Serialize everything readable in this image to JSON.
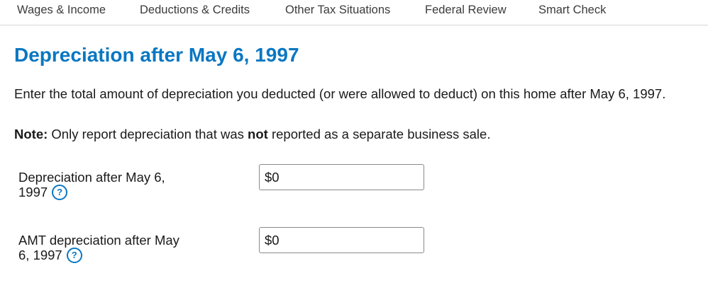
{
  "nav": {
    "items": [
      {
        "label": "Wages & Income"
      },
      {
        "label": "Deductions & Credits"
      },
      {
        "label": "Other Tax Situations"
      },
      {
        "label": "Federal Review"
      },
      {
        "label": "Smart Check"
      }
    ]
  },
  "page": {
    "title": "Depreciation after May 6, 1997",
    "instructions": "Enter the total amount of depreciation you deducted (or were allowed to deduct) on this home after May 6, 1997.",
    "note": {
      "label": "Note:",
      "text_before": " Only report depreciation that was ",
      "emphasis": "not",
      "text_after": " reported as a separate business sale."
    }
  },
  "fields": [
    {
      "label": "Depreciation after May 6, 1997",
      "value": "$0",
      "help_glyph": "?"
    },
    {
      "label": "AMT depreciation after May 6, 1997",
      "value": "$0",
      "help_glyph": "?"
    }
  ],
  "colors": {
    "accent": "#0a77c2",
    "text": "#1a1a1a",
    "nav_text": "#3b3b3b",
    "divider": "#d7d7d7"
  },
  "icons": {
    "help": "question-circle-icon"
  }
}
